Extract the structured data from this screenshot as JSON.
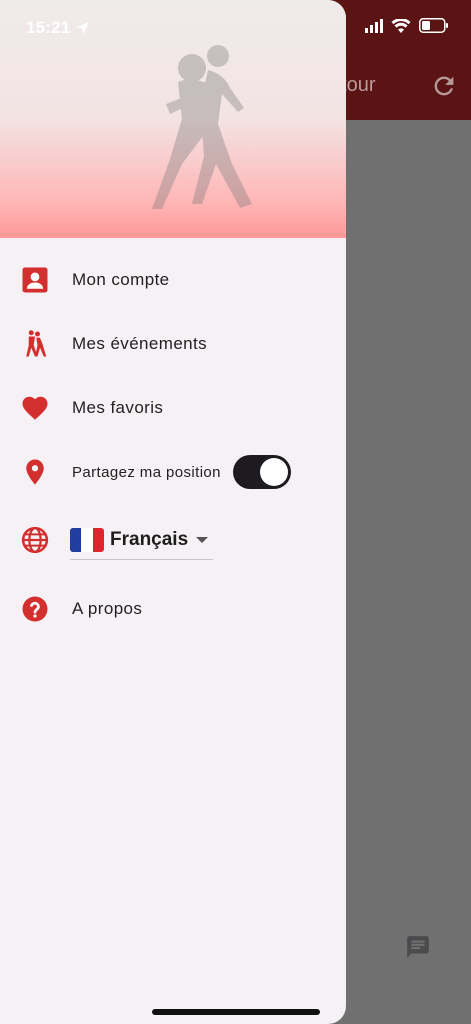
{
  "status_bar": {
    "time": "15:21"
  },
  "background": {
    "title_fragment": "atour"
  },
  "menu": {
    "account": "Mon compte",
    "events": "Mes événements",
    "favorites": "Mes favoris",
    "share_position": "Partagez ma position",
    "share_position_enabled": true,
    "language": "Français",
    "about": "A propos"
  },
  "colors": {
    "accent": "#d32f2f",
    "drawer_bg": "#f5f1f5",
    "scrim": "#717071",
    "appbar": "#5b1414"
  },
  "icons": {
    "account": "account-box-icon",
    "events": "dancers-icon",
    "favorites": "heart-icon",
    "position": "location-pin-icon",
    "language": "globe-icon",
    "about": "help-circle-icon"
  }
}
